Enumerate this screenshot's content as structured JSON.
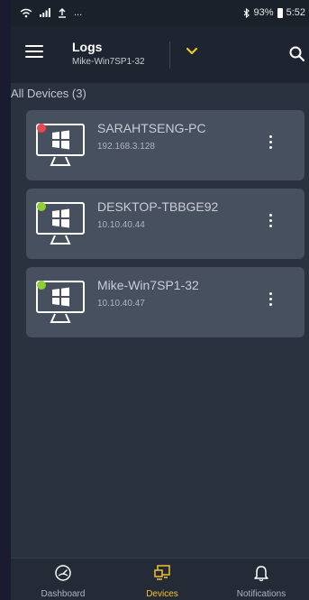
{
  "status_bar": {
    "battery": "93%",
    "time": "5:52",
    "ellipsis": "..."
  },
  "app_bar": {
    "title": "Logs",
    "subtitle": "Mike-Win7SP1-32"
  },
  "section": {
    "header": "All Devices (3)"
  },
  "devices": [
    {
      "name": "SARAHTSENG-PC",
      "ip": "192.168.3.128",
      "status": "offline",
      "status_color": "#e8474d"
    },
    {
      "name": "DESKTOP-TBBGE92",
      "ip": "10.10.40.44",
      "status": "online",
      "status_color": "#8ccf32"
    },
    {
      "name": "Mike-Win7SP1-32",
      "ip": "10.10.40.47",
      "status": "online",
      "status_color": "#8ccf32"
    }
  ],
  "bottom_nav": {
    "items": [
      {
        "label": "Dashboard",
        "icon": "gauge-icon",
        "active": false
      },
      {
        "label": "Devices",
        "icon": "devices-icon",
        "active": true
      },
      {
        "label": "Notifications",
        "icon": "bell-icon",
        "active": false
      }
    ]
  },
  "colors": {
    "accent": "#f2c230",
    "card_bg": "#46505e",
    "app_bg": "#2a3240"
  }
}
